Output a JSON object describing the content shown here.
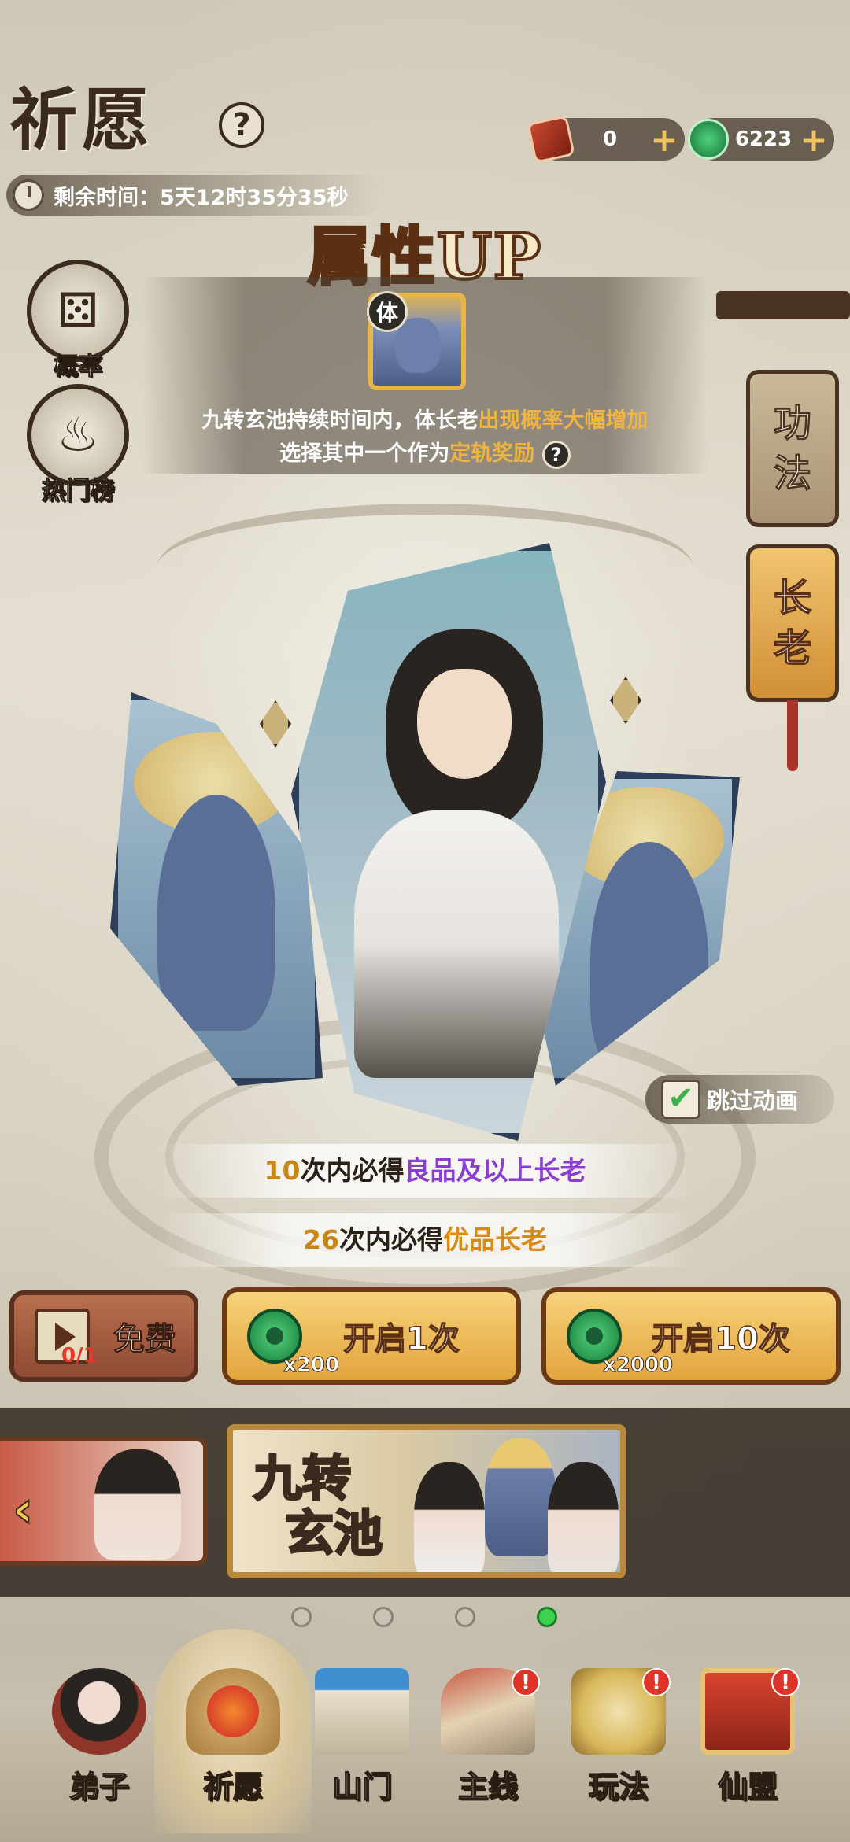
{
  "header": {
    "title": "祈愿",
    "help_glyph": "?",
    "currencies": [
      {
        "icon": "wish-token-icon",
        "value": "0",
        "plus": "+"
      },
      {
        "icon": "jade-icon",
        "value": "6223",
        "plus": "+"
      }
    ],
    "timer_label": "剩余时间：5天12时35分35秒"
  },
  "event": {
    "banner_title": "属性UP",
    "portrait_tag": "体",
    "line1_pre": "九转玄池持续时间内，体长老",
    "line1_hl": "出现概率大幅增加",
    "line2_pre": "选择其中一个作为",
    "line2_hl": "定轨奖励",
    "line2_help": "?"
  },
  "side": {
    "probability_label": "概率",
    "ranking_label": "热门榜"
  },
  "tabs": {
    "gongfa": [
      "功",
      "法"
    ],
    "zhanglao": [
      "长",
      "老"
    ]
  },
  "skip": {
    "check": "✔",
    "label": "跳过动画"
  },
  "guarantees": {
    "g1_num": "10",
    "g1_mid": "次内必得",
    "g1_hl": "良品及以上长老",
    "g2_num": "26",
    "g2_mid": "次内必得",
    "g2_hl": "优品长老"
  },
  "actions": {
    "free_count": "0/1",
    "free_label": "免费",
    "open1_cost": "x200",
    "open1_label": "开启1次",
    "open10_cost": "x2000",
    "open10_label": "开启10次"
  },
  "carousel": {
    "prev_arrow": "‹",
    "main_title_l1": "九转",
    "main_title_l2": "玄池",
    "pages": 4,
    "active_page": 4
  },
  "nav": {
    "items": [
      {
        "label": "弟子",
        "icon": "disciple-icon",
        "badge": ""
      },
      {
        "label": "祈愿",
        "icon": "wish-icon",
        "badge": "",
        "active": true
      },
      {
        "label": "山门",
        "icon": "gate-icon",
        "badge": ""
      },
      {
        "label": "主线",
        "icon": "main-quest-icon",
        "badge": "!"
      },
      {
        "label": "玩法",
        "icon": "gameplay-icon",
        "badge": "!"
      },
      {
        "label": "仙盟",
        "icon": "alliance-icon",
        "badge": "!"
      }
    ]
  }
}
